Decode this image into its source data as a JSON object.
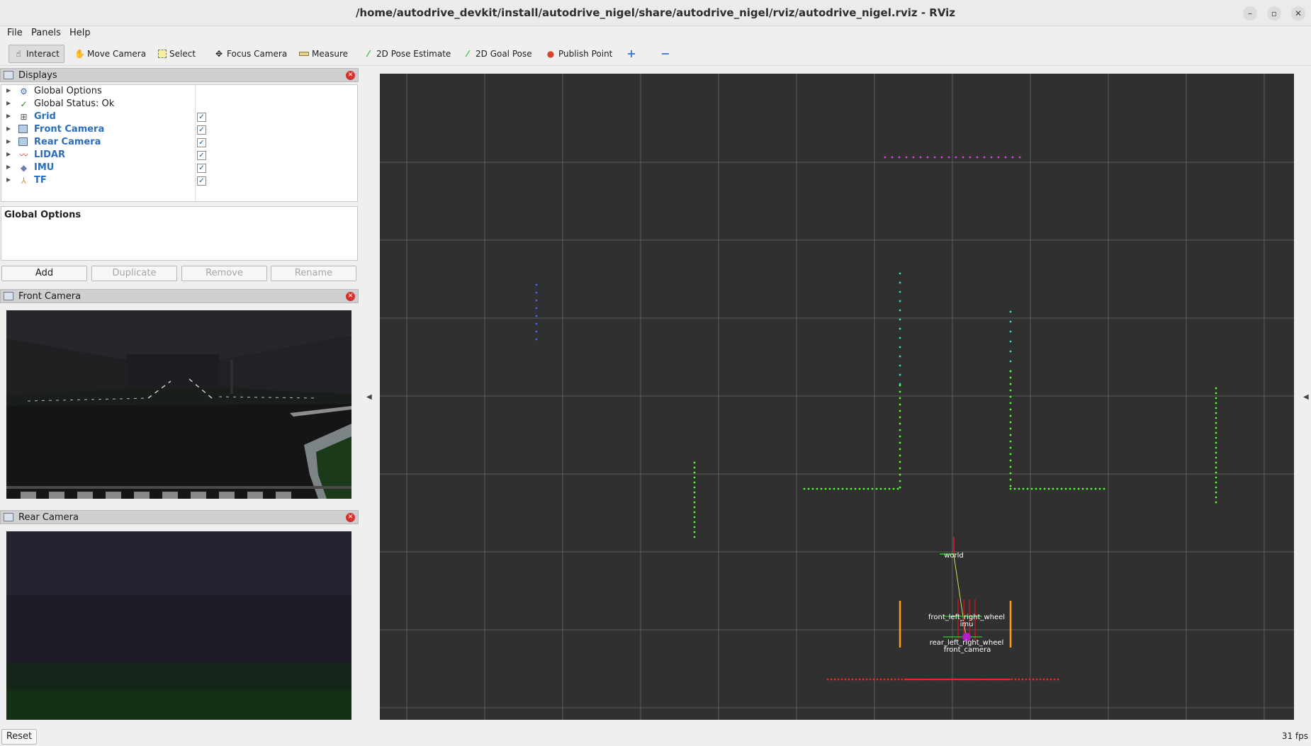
{
  "window": {
    "title": "/home/autodrive_devkit/install/autodrive_nigel/share/autodrive_nigel/rviz/autodrive_nigel.rviz - RViz",
    "minimize": "–",
    "maximize": "▫",
    "close": "✕"
  },
  "menu": {
    "file": "File",
    "panels": "Panels",
    "help": "Help"
  },
  "toolbar": {
    "interact": "Interact",
    "move_camera": "Move Camera",
    "select": "Select",
    "focus_camera": "Focus Camera",
    "measure": "Measure",
    "pose_estimate": "2D Pose Estimate",
    "goal_pose": "2D Goal Pose",
    "publish_point": "Publish Point",
    "add_tool": "+",
    "remove_tool": "−"
  },
  "displays": {
    "title": "Displays",
    "items": [
      {
        "label": "Global Options",
        "checked": null
      },
      {
        "label": "Global Status: Ok",
        "checked": null
      },
      {
        "label": "Grid",
        "checked": true
      },
      {
        "label": "Front Camera",
        "checked": true
      },
      {
        "label": "Rear Camera",
        "checked": true
      },
      {
        "label": "LIDAR",
        "checked": true
      },
      {
        "label": "IMU",
        "checked": true
      },
      {
        "label": "TF",
        "checked": true
      }
    ],
    "check_glyph": "✓",
    "properties_title": "Global Options",
    "buttons": {
      "add": "Add",
      "duplicate": "Duplicate",
      "remove": "Remove",
      "rename": "Rename"
    }
  },
  "front_camera": {
    "title": "Front Camera"
  },
  "rear_camera": {
    "title": "Rear Camera"
  },
  "viewport": {
    "tf_labels": {
      "world": "world",
      "front_wheel": "front_left_right_wheel",
      "imu": "imu",
      "rear_wheel": "rear_left_right_wheel",
      "front_camera": "front_camera"
    },
    "colors": {
      "background": "#303030",
      "grid": "#8c8c8c",
      "lidar_green": "#4cff2a",
      "lidar_cyan": "#39d6d0",
      "lidar_blue": "#3a6ef0",
      "lidar_magenta": "#e040e0",
      "lidar_red": "#ff2020",
      "tf_orange": "#ff9a10"
    }
  },
  "status": {
    "reset": "Reset",
    "fps": "31 fps"
  }
}
